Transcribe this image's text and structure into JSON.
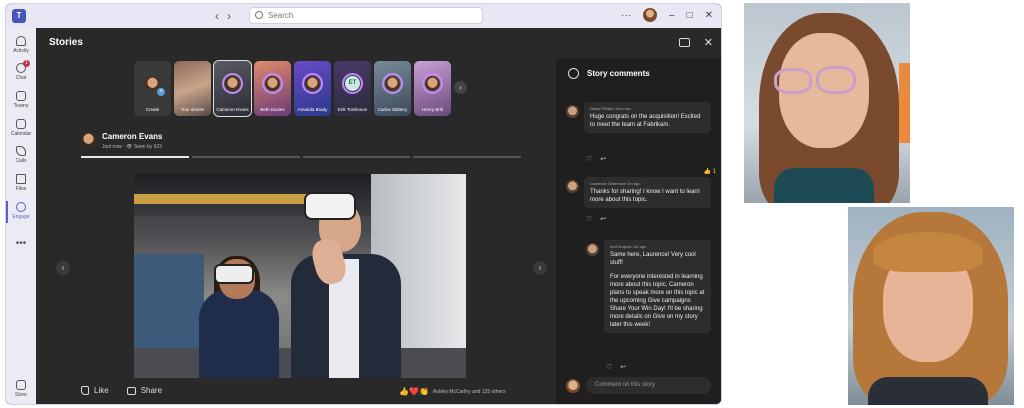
{
  "titlebar": {
    "search_placeholder": "Search",
    "back_icon": "chevron-left-icon",
    "forward_icon": "chevron-right-icon"
  },
  "rail": {
    "items": [
      {
        "label": "Activity",
        "icon": "bell-icon"
      },
      {
        "label": "Chat",
        "icon": "chat-icon",
        "badge": "1"
      },
      {
        "label": "Teams",
        "icon": "teams-icon"
      },
      {
        "label": "Calendar",
        "icon": "calendar-icon"
      },
      {
        "label": "Calls",
        "icon": "phone-icon"
      },
      {
        "label": "Files",
        "icon": "file-icon"
      },
      {
        "label": "Engage",
        "icon": "engage-icon"
      }
    ],
    "more": "•••",
    "store_label": "Store"
  },
  "stories": {
    "title": "Stories",
    "tiles": [
      {
        "label": "Create",
        "kind": "create"
      },
      {
        "label": "Your stories",
        "kind": "image"
      },
      {
        "label": "Cameron Evans",
        "kind": "avatar",
        "selected": true
      },
      {
        "label": "Beth Davies",
        "kind": "avatar"
      },
      {
        "label": "Amanda Brady",
        "kind": "avatar"
      },
      {
        "label": "Erik Tomlinson",
        "kind": "initials",
        "initials": "ET"
      },
      {
        "label": "Carlos Slattery",
        "kind": "avatar"
      },
      {
        "label": "Henry Brill",
        "kind": "avatar"
      }
    ]
  },
  "story": {
    "author_name": "Cameron Evans",
    "author_meta": "Just now · 👁 Seen by 623",
    "like_label": "Like",
    "share_label": "Share",
    "reactions_text": "Ashley McCarthy and 125 others",
    "reaction_emojis": [
      "👍",
      "❤️",
      "👏"
    ]
  },
  "comments_panel": {
    "title": "Story comments",
    "comments": [
      {
        "meta": "Daisy Phillips  Just now",
        "text": "Huge congrats on the acquisition! Excited to meet the team at Fabrikam."
      },
      {
        "meta": "Laurence Gilbertson  1m ago",
        "text": "Thanks for sharing! I know I want to learn more about this topic.",
        "reaction": "👍 1"
      },
      {
        "meta": "Avril Kapoor  1m ago",
        "text": "Same here, Laurence! Very cool stuff!",
        "text2": "For everyone interested in learning more about this topic, Cameron plans to speak more on this topic at the upcoming Give campaigns Share Your Win Day! I'll be sharing more details on Give on my story later this week!"
      }
    ],
    "input_placeholder": "Comment on this story"
  }
}
